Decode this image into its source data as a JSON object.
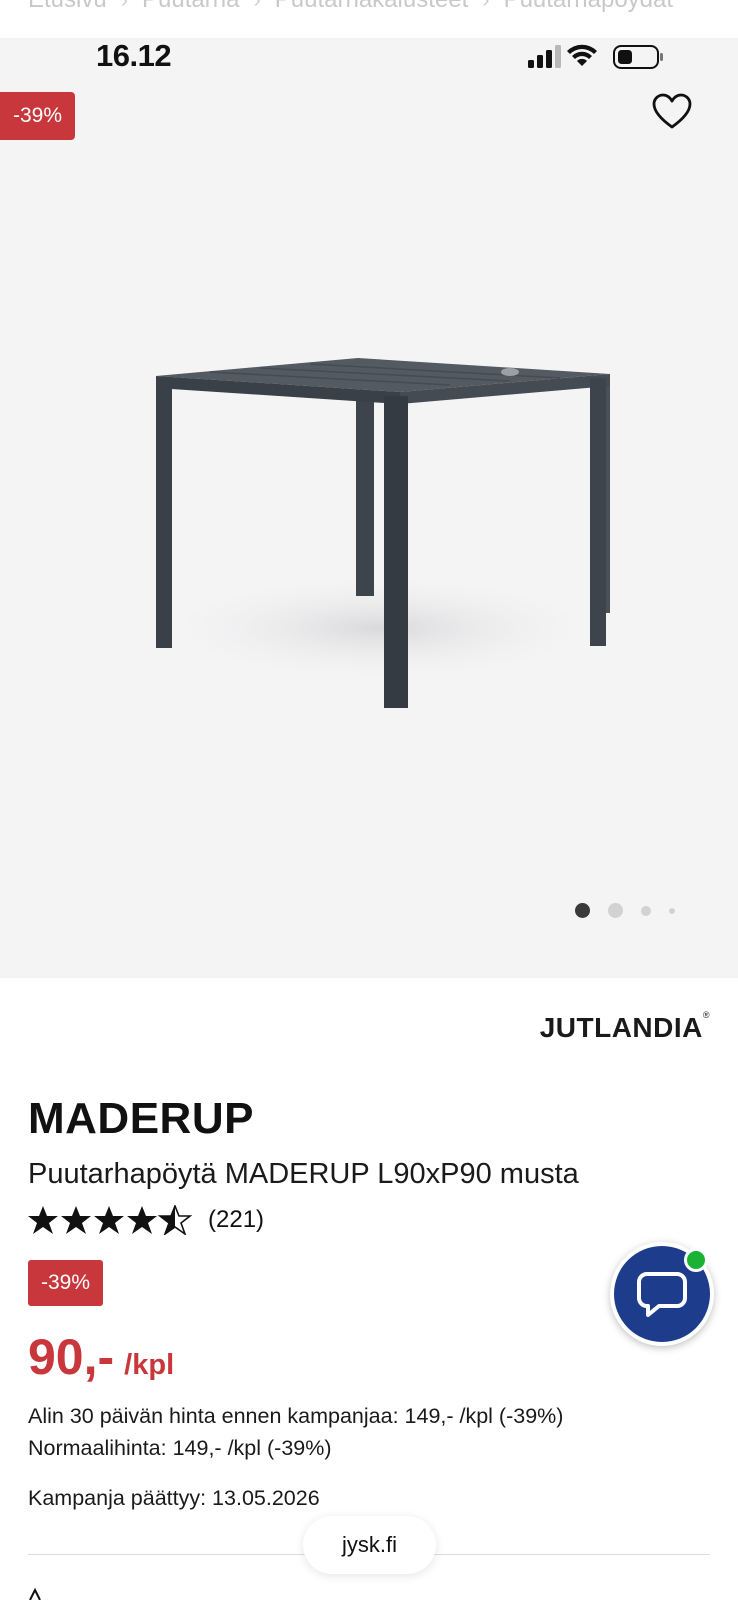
{
  "breadcrumb": [
    "Etusivu",
    "Puutarha",
    "Puutarhakalusteet",
    "Puutarhapöydät"
  ],
  "status_bar": {
    "time": "16.12"
  },
  "gallery": {
    "discount_badge": "-39%",
    "image_count": 4,
    "active_index": 0
  },
  "product": {
    "brand": "JUTLANDIA",
    "brand_mark": "®",
    "name": "MADERUP",
    "description": "Puutarhapöytä MADERUP L90xP90 musta",
    "rating": 4.5,
    "review_count": "(221)",
    "discount_badge": "-39%",
    "price": "90,-",
    "price_unit": "/kpl",
    "lowest_price_30d": "Alin 30 päivän hinta ennen kampanjaa: 149,- /kpl (-39%)",
    "normal_price": "Normaalihinta: 149,- /kpl (-39%)",
    "campaign_end": "Kampanja päättyy: 13.05.2026"
  },
  "browser": {
    "url": "jysk.fi"
  },
  "colors": {
    "sale_red": "#c8373b",
    "chat_blue": "#1e3c8c",
    "online_green": "#19b232",
    "gallery_bg": "#f4f4f5"
  }
}
